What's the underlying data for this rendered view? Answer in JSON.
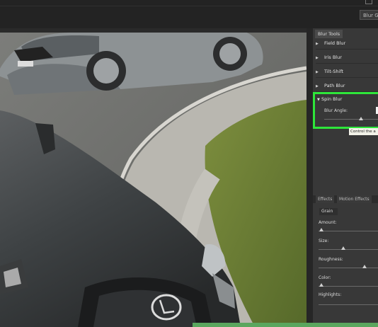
{
  "toolbar": {
    "blur_gallery_label": "Blur Ga"
  },
  "panel": {
    "tab_label": "Blur Tools",
    "blur_tools": [
      {
        "label": "Field Blur",
        "expanded": false
      },
      {
        "label": "Iris Blur",
        "expanded": false
      },
      {
        "label": "Tilt-Shift",
        "expanded": false
      },
      {
        "label": "Path Blur",
        "expanded": false
      },
      {
        "label": "Spin Blur",
        "expanded": true
      }
    ],
    "spin_blur": {
      "angle_label": "Blur Angle:",
      "tooltip": "Control the a"
    },
    "effects_tabs": [
      "Effects",
      "Motion Effects"
    ],
    "grain_tab": "Grain",
    "grain_controls": [
      {
        "label": "Amount:"
      },
      {
        "label": "Size:"
      },
      {
        "label": "Roughness:"
      },
      {
        "label": "Color:"
      },
      {
        "label": "Highlights:"
      }
    ]
  },
  "colors": {
    "highlight_box": "#2ee63a",
    "panel_bg": "#383838",
    "app_bg": "#1f1f1f"
  }
}
